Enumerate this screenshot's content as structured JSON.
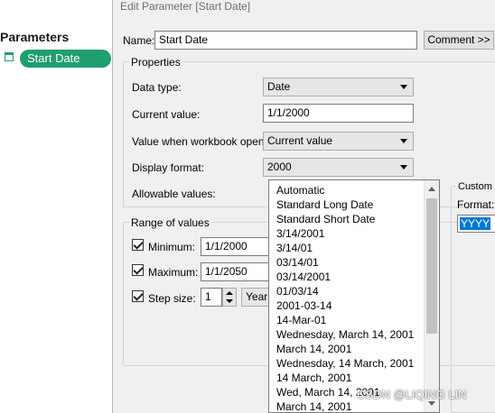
{
  "sidebar": {
    "title": "Parameters",
    "items": [
      {
        "label": "Start Date",
        "icon": "calendar-icon"
      }
    ]
  },
  "dialog": {
    "title": "Edit Parameter [Start Date]",
    "name_label": "Name:",
    "name_value": "Start Date",
    "comment_button": "Comment >>",
    "properties": {
      "title": "Properties",
      "data_type_label": "Data type:",
      "data_type_value": "Date",
      "current_value_label": "Current value:",
      "current_value": "1/1/2000",
      "workbook_opens_label": "Value when workbook opens:",
      "workbook_opens_value": "Current value",
      "display_format_label": "Display format:",
      "display_format_value": "2000",
      "allowable_values_label": "Allowable values:"
    },
    "range": {
      "title": "Range of values",
      "minimum_label": "Minimum:",
      "minimum_value": "1/1/2000",
      "minimum_checked": true,
      "maximum_label": "Maximum:",
      "maximum_value": "1/1/2050",
      "maximum_checked": true,
      "step_label": "Step size:",
      "step_value": "1",
      "step_checked": true,
      "step_unit": "Year"
    },
    "format_dropdown": {
      "options": [
        "Automatic",
        "Standard Long Date",
        "Standard Short Date",
        "3/14/2001",
        "3/14/01",
        "03/14/01",
        "03/14/2001",
        "01/03/14",
        "2001-03-14",
        "14-Mar-01",
        "Wednesday, March 14, 2001",
        "March 14, 2001",
        "Wednesday, 14 March, 2001",
        "14 March, 2001",
        "Wed, March 14, 2001",
        "March 14, 2001"
      ]
    },
    "custom": {
      "title": "Custom",
      "format_label": "Format:",
      "format_value": "YYYY"
    }
  },
  "watermark": "CSDN @LIQING LIN",
  "colors": {
    "accent": "#1f9e6e",
    "selection": "#0078d7",
    "dialog_bg": "#f0f0f0"
  }
}
